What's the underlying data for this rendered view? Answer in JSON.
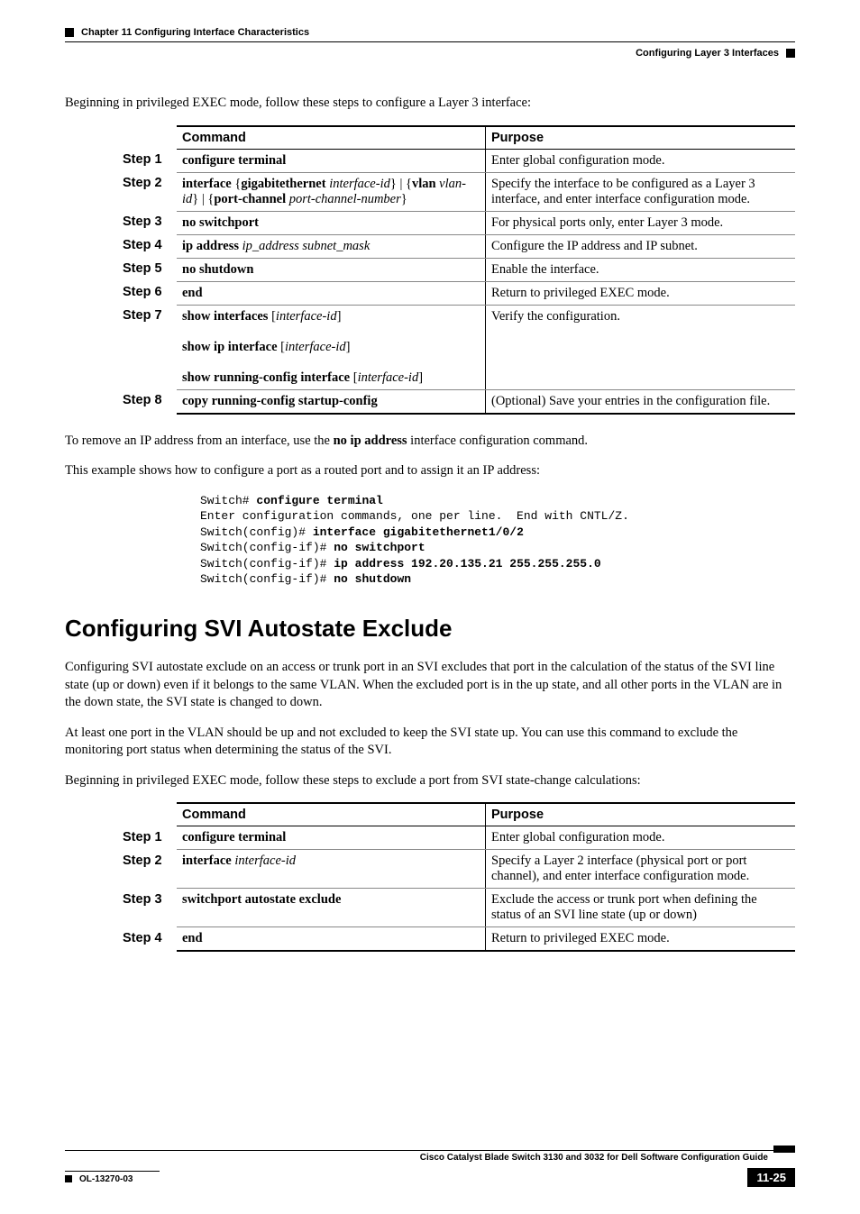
{
  "header": {
    "chapter": "Chapter 11      Configuring Interface Characteristics",
    "section": "Configuring Layer 3 Interfaces"
  },
  "intro1": "Beginning in privileged EXEC mode, follow these steps to configure a Layer 3 interface:",
  "table1": {
    "head_cmd": "Command",
    "head_purpose": "Purpose",
    "rows": [
      {
        "step": "Step 1",
        "cmd": "<span class='cmd-bold'>configure terminal</span>",
        "purpose": "Enter global configuration mode."
      },
      {
        "step": "Step 2",
        "cmd": "<span class='cmd-bold'>interface</span> {<span class='cmd-bold'>gigabitethernet</span> <span class='cmd-ital'>interface-id</span>} | {<span class='cmd-bold'>vlan</span> <span class='cmd-ital'>vlan-id</span>} | {<span class='cmd-bold'>port-channel</span> <span class='cmd-ital'>port-channel-number</span>}",
        "purpose": "Specify the interface to be configured as a Layer 3 interface, and enter interface configuration mode."
      },
      {
        "step": "Step 3",
        "cmd": "<span class='cmd-bold'>no switchport</span>",
        "purpose": "For physical ports only, enter Layer 3 mode."
      },
      {
        "step": "Step 4",
        "cmd": "<span class='cmd-bold'>ip address</span> <span class='cmd-ital'>ip_address subnet_mask</span>",
        "purpose": "Configure the IP address and IP subnet."
      },
      {
        "step": "Step 5",
        "cmd": "<span class='cmd-bold'>no shutdown</span>",
        "purpose": "Enable the interface."
      },
      {
        "step": "Step 6",
        "cmd": "<span class='cmd-bold'>end</span>",
        "purpose": "Return to privileged EXEC mode."
      },
      {
        "step": "Step 7",
        "cmd": "<span class='cmd-bold'>show interfaces</span> [<span class='cmd-ital'>interface-id</span>]<br><br><span class='cmd-bold'>show ip interface</span> [<span class='cmd-ital'>interface-id</span>]<br><br><span class='cmd-bold'>show running-config interface</span> [<span class='cmd-ital'>interface-id</span>]",
        "purpose": "Verify the configuration."
      },
      {
        "step": "Step 8",
        "cmd": "<span class='cmd-bold'>copy running-config startup-config</span>",
        "purpose": "(Optional) Save your entries in the configuration file."
      }
    ]
  },
  "para_remove_pre": "To remove an IP address from an interface, use the ",
  "para_remove_bold": "no ip address",
  "para_remove_post": " interface configuration command.",
  "para_example": "This example shows how to configure a port as a routed port and to assign it an IP address:",
  "cli": "Switch# <b>configure terminal</b>\nEnter configuration commands, one per line.  End with CNTL/Z.\nSwitch(config)# <b>interface gigabitethernet1/0/2</b>\nSwitch(config-if)# <b>no switchport</b>\nSwitch(config-if)# <b>ip address 192.20.135.21 255.255.255.0</b>\nSwitch(config-if)# <b>no shutdown</b>",
  "h2": "Configuring SVI Autostate Exclude",
  "svi_p1": "Configuring SVI autostate exclude on an access or trunk port in an SVI excludes that port in the calculation of the status of the SVI line state (up or down) even if it belongs to the same VLAN. When the excluded port is in the up state, and all other ports in the VLAN are in the down state, the SVI state is changed to down.",
  "svi_p2": "At least one port in the VLAN should be up and not excluded to keep the SVI state up. You can use this command to exclude the monitoring port status when determining the status of the SVI.",
  "svi_p3": "Beginning in privileged EXEC mode, follow these steps to exclude a port from SVI state-change calculations:",
  "table2": {
    "head_cmd": "Command",
    "head_purpose": "Purpose",
    "rows": [
      {
        "step": "Step 1",
        "cmd": "<span class='cmd-bold'>configure terminal</span>",
        "purpose": "Enter global configuration mode."
      },
      {
        "step": "Step 2",
        "cmd": "<span class='cmd-bold'>interface</span> <span class='cmd-ital'>interface-id</span>",
        "purpose": "Specify a Layer 2 interface (physical port or port channel), and enter interface configuration mode."
      },
      {
        "step": "Step 3",
        "cmd": "<span class='cmd-bold'>switchport autostate exclude</span>",
        "purpose": "Exclude the access or trunk port when defining the status of an SVI line state (up or down)"
      },
      {
        "step": "Step 4",
        "cmd": "<span class='cmd-bold'>end</span>",
        "purpose": "Return to privileged EXEC mode."
      }
    ]
  },
  "footer": {
    "guide": "Cisco Catalyst Blade Switch 3130 and 3032 for Dell Software Configuration Guide",
    "docid": "OL-13270-03",
    "page": "11-25"
  }
}
